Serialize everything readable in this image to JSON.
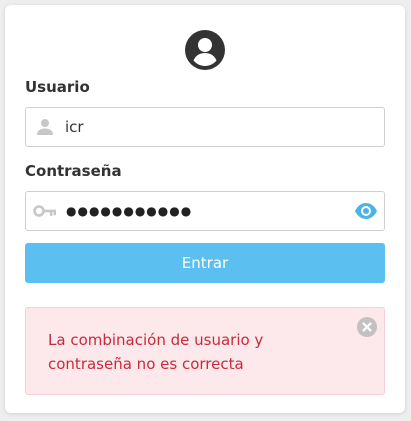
{
  "login": {
    "username_label": "Usuario",
    "username_value": "icr",
    "password_label": "Contraseña",
    "password_mask": "●●●●●●●●●●●",
    "submit_label": "Entrar"
  },
  "error": {
    "message": "La combinación de usuario y contraseña no es correcta"
  },
  "icons": {
    "avatar": "account-circle-icon",
    "user_field": "person-icon",
    "password_field": "key-icon",
    "toggle_password": "eye-icon",
    "dismiss_error": "close-circle-icon"
  },
  "colors": {
    "primary_button": "#5bc0ef",
    "eye_icon": "#4db3e6",
    "error_background": "#fde8ec",
    "error_text": "#c72a3b"
  }
}
